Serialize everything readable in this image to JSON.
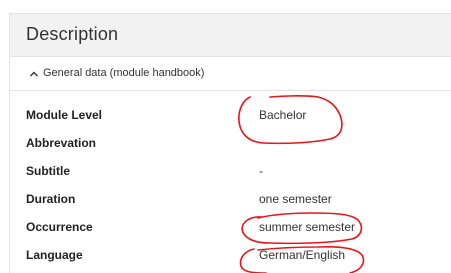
{
  "panel": {
    "title": "Description"
  },
  "section": {
    "label": "General data (module handbook)",
    "icon": "chevron-up-icon"
  },
  "rows": [
    {
      "label": "Module Level",
      "value": "Bachelor"
    },
    {
      "label": "Abbrevation",
      "value": ""
    },
    {
      "label": "Subtitle",
      "value": "-"
    },
    {
      "label": "Duration",
      "value": "one semester"
    },
    {
      "label": "Occurrence",
      "value": "summer semester"
    },
    {
      "label": "Language",
      "value": "German/English"
    }
  ],
  "annotation_color": "#e8131b"
}
